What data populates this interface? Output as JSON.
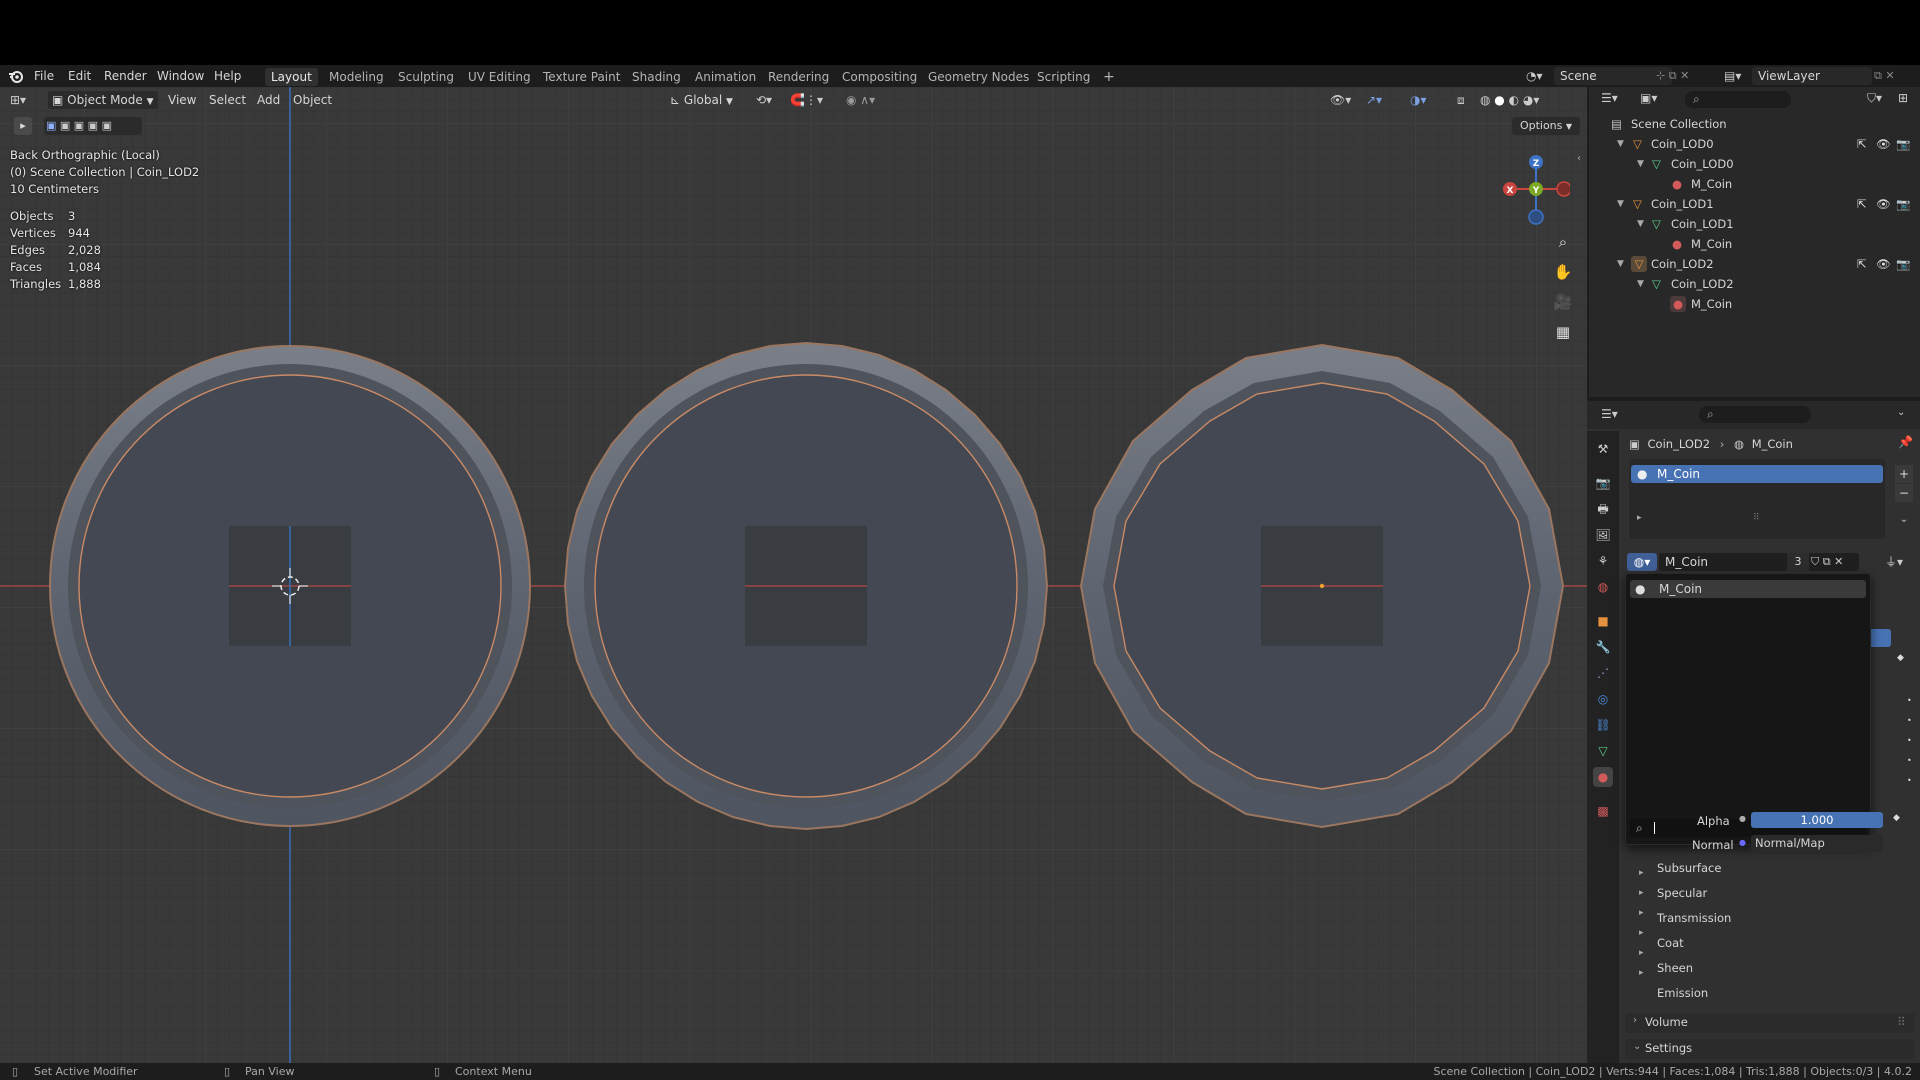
{
  "menus": [
    "File",
    "Edit",
    "Render",
    "Window",
    "Help"
  ],
  "workspaces": [
    {
      "label": "Layout",
      "active": true
    },
    {
      "label": "Modeling"
    },
    {
      "label": "Sculpting"
    },
    {
      "label": "UV Editing"
    },
    {
      "label": "Texture Paint"
    },
    {
      "label": "Shading"
    },
    {
      "label": "Animation"
    },
    {
      "label": "Rendering"
    },
    {
      "label": "Compositing"
    },
    {
      "label": "Geometry Nodes"
    },
    {
      "label": "Scripting"
    }
  ],
  "add_workspace_glyph": "+",
  "scene": {
    "name": "Scene"
  },
  "view_layer": {
    "name": "ViewLayer"
  },
  "viewport": {
    "mode": "Object Mode",
    "menus": [
      "View",
      "Select",
      "Add",
      "Object"
    ],
    "transform_orientation": "Global",
    "options_label": "Options",
    "view_name": "Back Orthographic (Local)",
    "collection_line": "(0) Scene Collection | Coin_LOD2",
    "scale_line": "10 Centimeters",
    "stats": [
      {
        "label": "Objects",
        "value": "3"
      },
      {
        "label": "Vertices",
        "value": "944"
      },
      {
        "label": "Edges",
        "value": "2,028"
      },
      {
        "label": "Faces",
        "value": "1,084"
      },
      {
        "label": "Triangles",
        "value": "1,888"
      }
    ],
    "gizmo": {
      "z": "Z",
      "y": "Y",
      "x": "X"
    }
  },
  "outliner": {
    "root": "Scene Collection",
    "items": [
      {
        "label": "Coin_LOD0",
        "kind": "object"
      },
      {
        "label": "Coin_LOD0",
        "kind": "mesh"
      },
      {
        "label": "M_Coin",
        "kind": "material"
      },
      {
        "label": "Coin_LOD1",
        "kind": "object"
      },
      {
        "label": "Coin_LOD1",
        "kind": "mesh"
      },
      {
        "label": "M_Coin",
        "kind": "material"
      },
      {
        "label": "Coin_LOD2",
        "kind": "object"
      },
      {
        "label": "Coin_LOD2",
        "kind": "mesh"
      },
      {
        "label": "M_Coin",
        "kind": "material"
      }
    ]
  },
  "properties": {
    "breadcrumb_object": "Coin_LOD2",
    "breadcrumb_material": "M_Coin",
    "slot_label": "M_Coin",
    "material_name": "M_Coin",
    "user_count": "3",
    "dropdown_item": "M_Coin",
    "alpha_label": "Alpha",
    "alpha_value": "1.000",
    "normal_label": "Normal",
    "normal_value": "Normal/Map",
    "sections": [
      "Subsurface",
      "Specular",
      "Transmission",
      "Coat",
      "Sheen",
      "Emission"
    ],
    "volume": "Volume",
    "settings": "Settings"
  },
  "statusbar": {
    "left": "Set Active Modifier",
    "mid": "Pan View",
    "right_menu": "Context Menu",
    "info": "Scene Collection | Coin_LOD2 | Verts:944 | Faces:1,084 | Tris:1,888 | Objects:0/3 | 4.0.2"
  },
  "colors": {
    "accent": "#4772b3",
    "axis_x": "#c8463f",
    "axis_y": "#7ea825",
    "axis_z": "#3e72c4",
    "object_orange": "#e3913f"
  }
}
